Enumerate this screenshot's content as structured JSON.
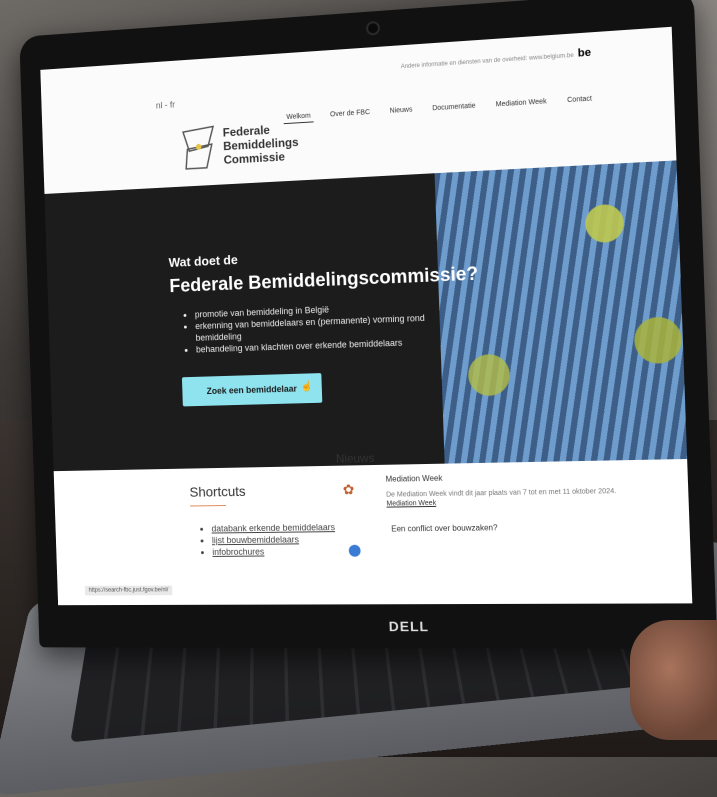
{
  "site": {
    "lang_switch": "nl - fr",
    "gov_bar": "Andere informatie en diensten van de overheid: www.belgium.be",
    "gov_bar_logo": "be",
    "logo_text": "Federale Bemiddelings Commissie",
    "nav": [
      "Welkom",
      "Over de FBC",
      "Nieuws",
      "Documentatie",
      "Mediation Week",
      "Contact"
    ],
    "hero": {
      "subtitle": "Wat doet de",
      "title": "Federale Bemiddelingscommissie?",
      "bullets": [
        "promotie van bemiddeling in België",
        "erkenning van bemiddelaars en (permanente) vorming rond bemiddeling",
        "behandeling van klachten over erkende bemiddelaars"
      ],
      "cta_label": "Zoek een bemiddelaar"
    },
    "shortcuts": {
      "title": "Shortcuts",
      "items": [
        "databank erkende bemiddelaars",
        "lijst bouwbemiddelaars",
        "infobrochures"
      ]
    },
    "news": {
      "title": "Nieuws",
      "item1_title": "Mediation Week",
      "item1_body": "De Mediation Week vindt dit jaar plaats van 7 tot en met 11 oktober 2024.",
      "item1_link": "Mediation Week",
      "item2_title": "Een conflict over bouwzaken?"
    },
    "status_url": "https://search-fbc.just.fgov.be/nl/"
  },
  "device": {
    "brand": "DELL"
  },
  "colors": {
    "cta": "#8ee3ef",
    "hero_bg": "#1c1c1c",
    "accent_line": "#e08b5a"
  }
}
